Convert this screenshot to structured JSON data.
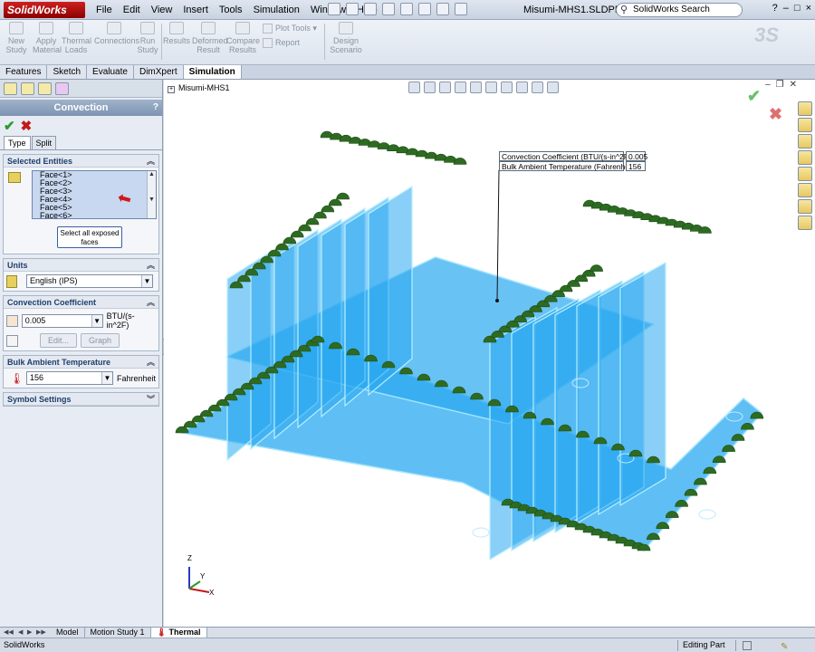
{
  "app": {
    "logo": "SolidWorks",
    "document_title": "Misumi-MHS1.SLDPRT *"
  },
  "menu": [
    "File",
    "Edit",
    "View",
    "Insert",
    "Tools",
    "Simulation",
    "Window",
    "Help"
  ],
  "search": {
    "placeholder": "SolidWorks Search"
  },
  "title_controls": [
    "?",
    "–",
    "□",
    "×"
  ],
  "command_manager": {
    "new_study": "New Study",
    "apply_material": "Apply Material",
    "thermal_loads": "Thermal Loads",
    "connections": "Connections",
    "run_study": "Run Study",
    "results": "Results",
    "deformed_result": "Deformed Result",
    "compare_results": "Compare Results",
    "plot_tools": "Plot Tools",
    "report": "Report",
    "design_scenario": "Design Scenario"
  },
  "command_tabs": [
    "Features",
    "Sketch",
    "Evaluate",
    "DimXpert",
    "Simulation"
  ],
  "property_manager": {
    "title": "Convection",
    "help": "?",
    "ok_symbol": "✔",
    "cancel_symbol": "✖",
    "tabs": [
      "Type",
      "Split"
    ],
    "selected_entities": {
      "title": "Selected Entities",
      "faces": [
        "Face<1>",
        "Face<2>",
        "Face<3>",
        "Face<4>",
        "Face<5>",
        "Face<6>"
      ],
      "select_all_button": "Select all exposed faces"
    },
    "units": {
      "title": "Units",
      "value": "English (IPS)"
    },
    "convection_coefficient": {
      "title": "Convection Coefficient",
      "value": "0.005",
      "unit": "BTU/(s-in^2F)",
      "edit_button": "Edit...",
      "graph_button": "Graph"
    },
    "bulk_ambient": {
      "title": "Bulk Ambient Temperature",
      "value": "156",
      "unit": "Fahrenheit"
    },
    "symbol_settings": {
      "title": "Symbol Settings"
    }
  },
  "viewport": {
    "tree_root": "Misumi-MHS1",
    "callout": [
      {
        "label": "Convection Coefficient (BTU/(s-in^2F)):",
        "value": "0.005"
      },
      {
        "label": "Bulk Ambient Temperature (Fahrenheit):",
        "value": "156"
      }
    ],
    "triad": {
      "x": "X",
      "y": "Y",
      "z": "Z"
    },
    "model_color": "#2aa8f0",
    "symbol_color": "#2e6b22"
  },
  "bottom_tabs": [
    "Model",
    "Motion Study 1",
    "Thermal"
  ],
  "status": {
    "left": "SolidWorks",
    "right": "Editing Part"
  },
  "colors": {
    "accent": "#7d94b2",
    "ok": "#2a9a2a",
    "cancel": "#c41818"
  }
}
